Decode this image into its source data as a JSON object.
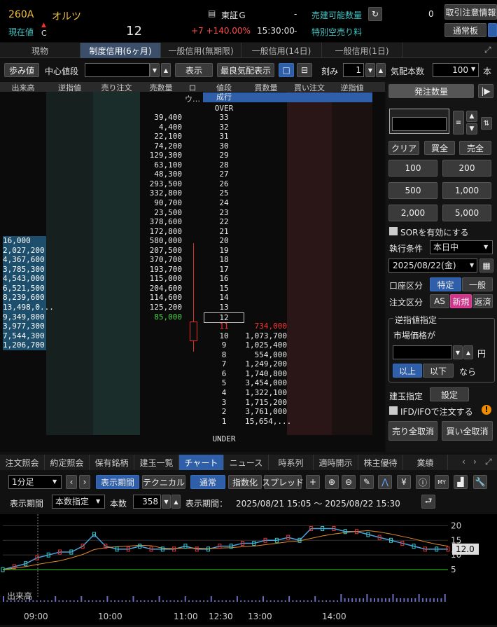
{
  "header": {
    "code": "260A",
    "name": "オルツ",
    "label_price": "現在値",
    "c_mark": "C",
    "price": "12",
    "exchange": "東証Ｇ",
    "dash1": "-",
    "sell_qty_label": "売建可能数量",
    "sell_qty": "0",
    "notice_btn": "取引注意情報",
    "change": "+7 +140.00%",
    "time": "15:30:00",
    "dash2": "-",
    "short_fee": "特別空売り料",
    "mode_btn": "通常板"
  },
  "tabs": [
    "現物",
    "制度信用(6ヶ月)",
    "一般信用(無期限)",
    "一般信用(14日)",
    "一般信用(1日)"
  ],
  "toolbar": {
    "tick_btn": "歩み値",
    "center_label": "中心値段",
    "show_btn": "表示",
    "best_btn": "最良気配表示",
    "kizami": "刻み",
    "kizami_val": "1",
    "kehai_label": "気配本数",
    "kehai_val": "100",
    "hon": "本"
  },
  "board": {
    "columns": [
      "出来高",
      "逆指値",
      "売り注文",
      "売数量",
      "ロウ…",
      "値段",
      "買数量",
      "買い注文",
      "逆指値"
    ],
    "top_label": "成行",
    "over": "OVER",
    "under": "UNDER",
    "prices": [
      "33",
      "32",
      "31",
      "30",
      "29",
      "28",
      "27",
      "26",
      "25",
      "24",
      "23",
      "22",
      "21",
      "20",
      "19",
      "18",
      "17",
      "16",
      "15",
      "14",
      "13",
      "12",
      "11",
      "10",
      "9",
      "8",
      "7",
      "6",
      "5",
      "4",
      "3",
      "2",
      "1"
    ],
    "ask": [
      "39,400",
      "4,400",
      "22,100",
      "74,200",
      "129,300",
      "63,100",
      "48,300",
      "293,500",
      "332,800",
      "90,700",
      "23,500",
      "378,600",
      "172,800",
      "580,000",
      "207,500",
      "370,700",
      "193,700",
      "115,000",
      "204,600",
      "114,600",
      "125,200",
      "85,000",
      "",
      "",
      "",
      "",
      "",
      "",
      "",
      "",
      "",
      "",
      ""
    ],
    "bid": [
      "",
      "",
      "",
      "",
      "",
      "",
      "",
      "",
      "",
      "",
      "",
      "",
      "",
      "",
      "",
      "",
      "",
      "",
      "",
      "",
      "",
      "",
      "734,000",
      "1,073,700",
      "1,025,400",
      "554,000",
      "1,249,200",
      "1,740,800",
      "3,454,000",
      "1,322,100",
      "1,715,200",
      "3,761,000",
      "15,654,..."
    ],
    "volume": [
      "",
      "",
      "",
      "",
      "",
      "",
      "",
      "",
      "",
      "",
      "",
      "",
      "",
      "16,000",
      "2,027,200",
      "4,367,600",
      "3,785,300",
      "4,543,000",
      "6,521,500",
      "8,239,600",
      "13,498,0...",
      "9,349,800",
      "3,977,300",
      "7,544,300",
      "1,206,700",
      "",
      "",
      "",
      "",
      "",
      "",
      "",
      ""
    ]
  },
  "order": {
    "title": "発注数量",
    "clear": "クリア",
    "all_buy": "買全",
    "all_sell": "売全",
    "q100": "100",
    "q200": "200",
    "q500": "500",
    "q1000": "1,000",
    "q2000": "2,000",
    "q5000": "5,000",
    "sor": "SORを有効にする",
    "cond_label": "執行条件",
    "cond_val": "本日中",
    "date": "2025/08/22(金)",
    "acct_label": "口座区分",
    "acct1": "特定",
    "acct2": "一般",
    "type_label": "注文区分",
    "as": "AS",
    "new": "新規",
    "close": "返済",
    "stop_title": "逆指値指定",
    "market_label": "市場価格が",
    "yen": "円",
    "ijo": "以上",
    "ika": "以下",
    "nara": "なら",
    "pos_label": "建玉指定",
    "setting": "設定",
    "ifd": "IFD/IFOで注文する",
    "cancel_sell": "売り全取消",
    "cancel_buy": "買い全取消"
  },
  "bottom_tabs": [
    "注文照会",
    "約定照会",
    "保有銘柄",
    "建玉一覧",
    "チャート",
    "ニュース",
    "時系列",
    "適時開示",
    "株主優待",
    "業績"
  ],
  "chart_ctrl": {
    "interval": "1分足",
    "period_btn": "表示期間",
    "tech_btn": "テクニカル",
    "normal": "通常",
    "index": "指数化",
    "spread": "スプレッド",
    "period_label": "表示期間",
    "spec": "本数指定",
    "count_label": "本数",
    "count": "358",
    "range_label": "表示期間：",
    "range": "2025/08/21 15:05 〜 2025/08/22 15:30"
  },
  "chart_data": {
    "type": "line",
    "title": "",
    "current": "12.0",
    "y_ticks": [
      "20",
      "15",
      "10",
      "5"
    ],
    "x_ticks": [
      "09:00",
      "10:00",
      "11:00",
      "12:30",
      "13:00",
      "14:00"
    ],
    "volume_label": "出来高",
    "series": [
      {
        "values": [
          5,
          6,
          7,
          9,
          10,
          11,
          11,
          13,
          17,
          13,
          12,
          12,
          13,
          12,
          12,
          12,
          13,
          12,
          12,
          13,
          13,
          14,
          14,
          15,
          15,
          16,
          15,
          19,
          19,
          19,
          18,
          18,
          17,
          16,
          15,
          14,
          13,
          12,
          12,
          12
        ]
      }
    ],
    "ylim": [
      0,
      22
    ]
  }
}
